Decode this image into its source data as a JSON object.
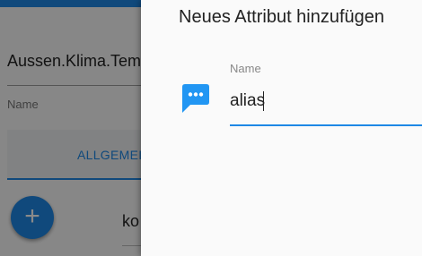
{
  "background": {
    "field_value": "Aussen.Klima.Temperatur",
    "field_label": "Name",
    "tab_label": "ALLGEMEIN",
    "fab_icon": "plus-icon",
    "row_text": "ko"
  },
  "dialog": {
    "title": "Neues Attribut hinzufügen",
    "name_icon": "message-dots-icon",
    "name_field": {
      "label": "Name",
      "value": "alias"
    }
  },
  "colors": {
    "accent": "#1e88e5",
    "dialog_background": "#fafafa",
    "backdrop": "rgba(0,0,0,0.46)"
  }
}
